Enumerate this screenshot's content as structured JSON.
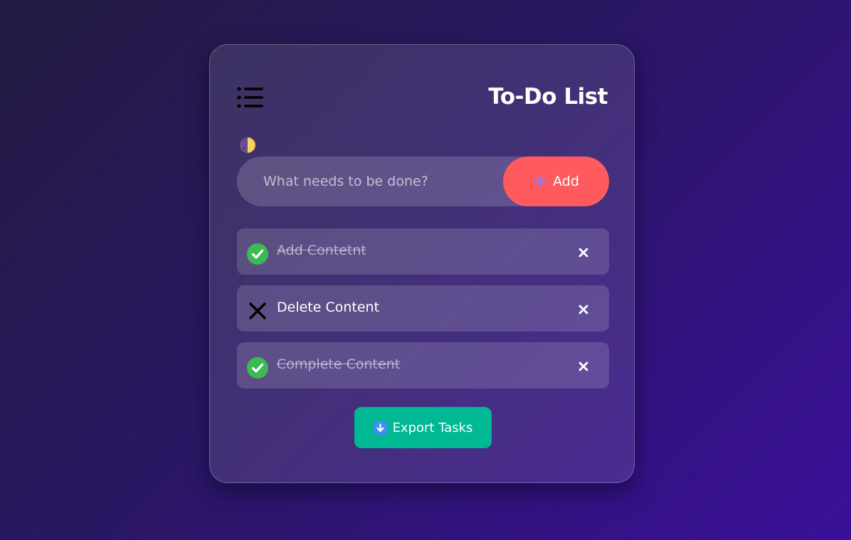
{
  "app": {
    "title": "To-Do List"
  },
  "header": {
    "menu_icon": "list-menu-icon",
    "theme_toggle_icon": "half-moon-theme-icon"
  },
  "input": {
    "placeholder": "What needs to be done?",
    "value": "",
    "add_label": "Add",
    "add_icon": "plus-icon"
  },
  "tasks": [
    {
      "text": "Add Contetnt",
      "completed": true,
      "status_icon": "check-circle-icon"
    },
    {
      "text": "Delete Content",
      "completed": false,
      "status_icon": "cross-mark-icon"
    },
    {
      "text": "Complete Content",
      "completed": true,
      "status_icon": "check-circle-icon"
    }
  ],
  "export": {
    "label": "Export Tasks",
    "icon": "down-arrow-icon"
  },
  "colors": {
    "accent_add": "#ff5b5f",
    "accent_export": "#00b894",
    "complete_green": "#3cba54",
    "background_start": "#221a40",
    "background_end": "#3a0f99"
  }
}
